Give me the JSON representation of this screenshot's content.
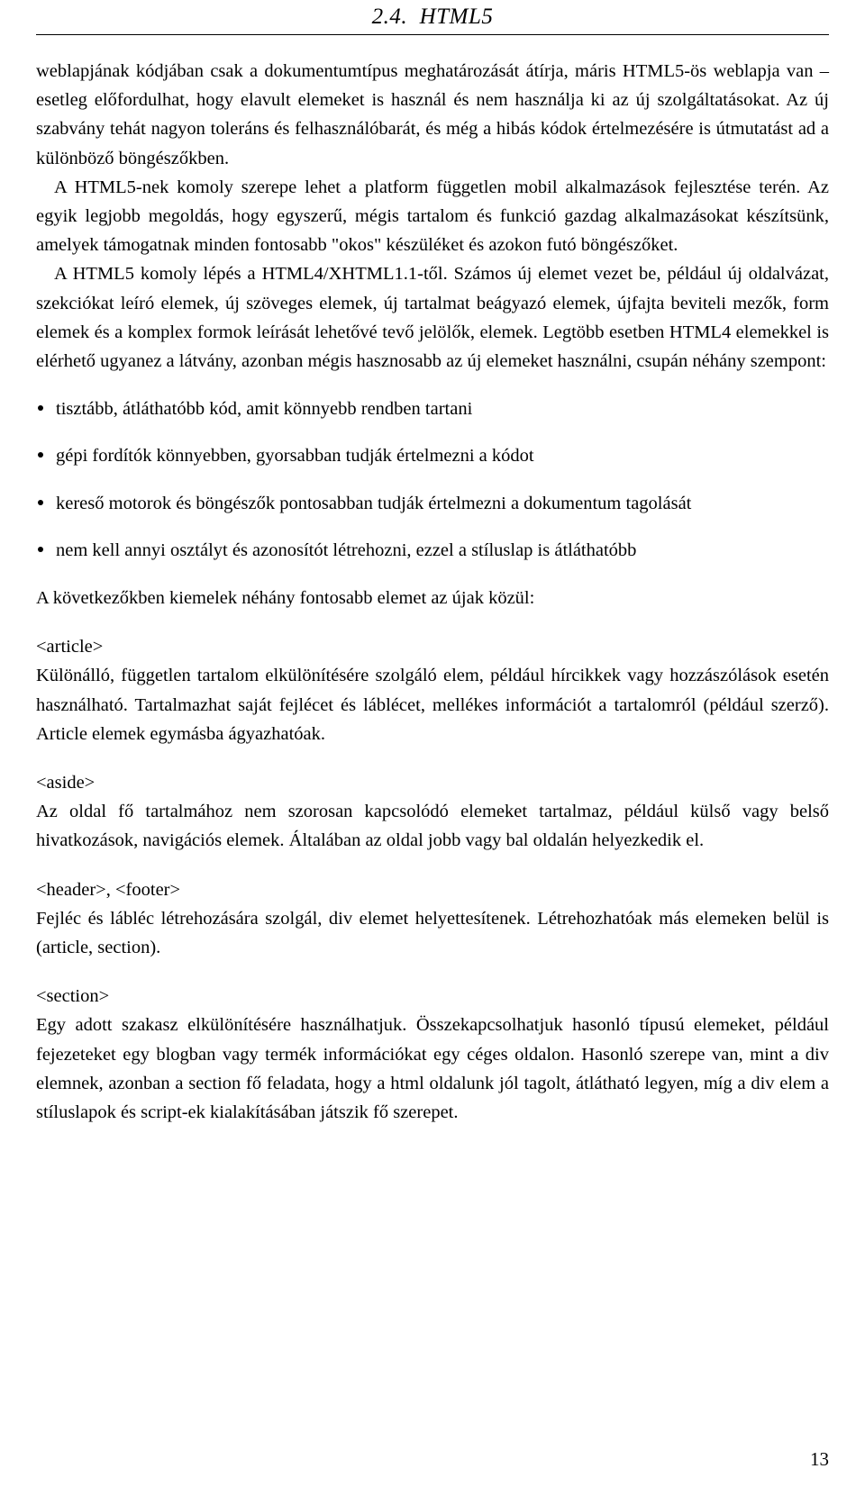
{
  "header": {
    "running_title": "2.4.  HTML5"
  },
  "body": {
    "paragraph_1": "weblapjának kódjában csak a dokumentumtípus meghatározását átírja, máris HTML5-ös weblapja van – esetleg előfordulhat, hogy elavult elemeket is használ és nem használja ki az új szolgáltatásokat. Az új szabvány tehát nagyon toleráns és felhasználóbarát, és még a hibás kódok értelmezésére is útmutatást ad a különböző böngészőkben.",
    "paragraph_2": "A HTML5-nek komoly szerepe lehet a platform független mobil alkalmazások fejlesztése terén. Az egyik legjobb megoldás, hogy egyszerű, mégis tartalom és funkció gazdag alkalmazásokat készítsünk, amelyek támogatnak minden fontosabb \"okos\" készüléket és azokon futó böngészőket.",
    "paragraph_3": "A HTML5 komoly lépés a HTML4/XHTML1.1-től. Számos új elemet vezet be, például új oldalvázat, szekciókat leíró elemek, új szöveges elemek, új tartalmat beágyazó elemek, újfajta beviteli mezők, form elemek és a komplex formok leírását lehetővé tevő jelölők, elemek. Legtöbb esetben HTML4 elemekkel is elérhető ugyanez a látvány, azonban mégis hasznosabb az új elemeket használni, csupán néhány szempont:",
    "bullets": [
      "tisztább, átláthatóbb kód, amit könnyebb rendben tartani",
      "gépi fordítók könnyebben, gyorsabban tudják értelmezni a kódot",
      "kereső motorok és böngészők pontosabban tudják értelmezni a dokumentum tagolását",
      "nem kell annyi osztályt és azonosítót létrehozni, ezzel a stíluslap is átláthatóbb"
    ],
    "paragraph_4": "A következőkben kiemelek néhány fontosabb elemet az újak közül:",
    "sections": [
      {
        "tag": "<article>",
        "text": "Különálló, független tartalom elkülönítésére szolgáló elem, például hírcikkek vagy hozzászólások esetén használható. Tartalmazhat saját fejlécet és láblécet, mellékes információt a tartalomról (például szerző). Article elemek egymásba ágyazhatóak."
      },
      {
        "tag": "<aside>",
        "text": "Az oldal fő tartalmához nem szorosan kapcsolódó elemeket tartalmaz, például külső vagy belső hivatkozások, navigációs elemek. Általában az oldal jobb vagy bal oldalán helyezkedik el."
      },
      {
        "tag": "<header>, <footer>",
        "text": "Fejléc és lábléc létrehozására szolgál, div elemet helyettesítenek. Létrehozhatóak más elemeken belül is (article, section)."
      },
      {
        "tag": "<section>",
        "text": "Egy adott szakasz elkülönítésére használhatjuk. Összekapcsolhatjuk hasonló típusú elemeket, például fejezeteket egy blogban vagy termék információkat egy céges oldalon. Hasonló szerepe van, mint a div elemnek, azonban a section fő feladata, hogy a html oldalunk jól tagolt, átlátható legyen, míg a div elem a stíluslapok és script-ek kialakításában játszik fő szerepet."
      }
    ]
  },
  "footer": {
    "page_number": "13"
  }
}
